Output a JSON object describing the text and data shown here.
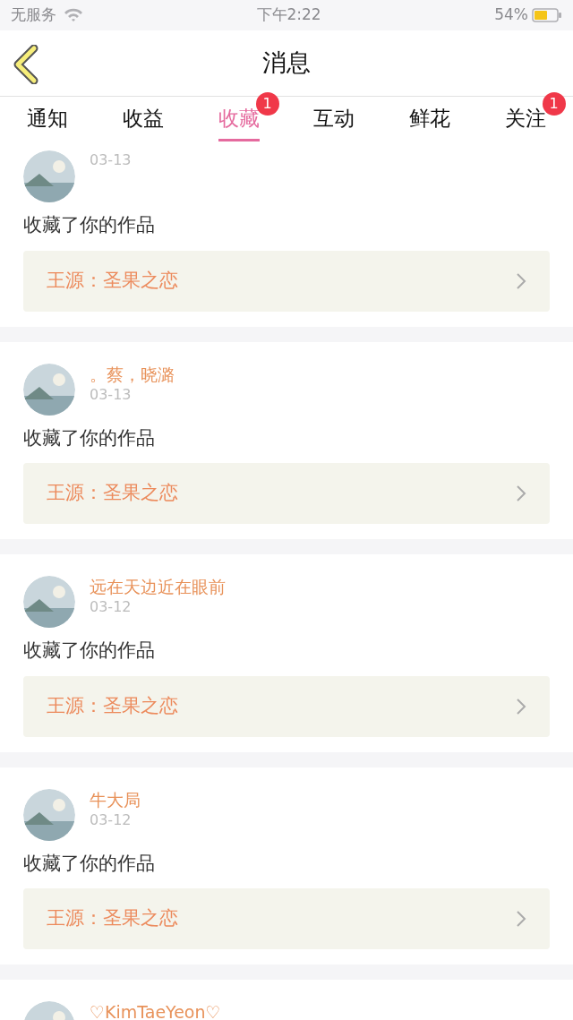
{
  "status_bar": {
    "carrier": "无服务",
    "time": "下午2:22",
    "battery": "54%"
  },
  "header": {
    "title": "消息"
  },
  "tabs": [
    {
      "label": "通知",
      "selected": false
    },
    {
      "label": "收益",
      "selected": false
    },
    {
      "label": "收藏",
      "selected": true,
      "badge": "1"
    },
    {
      "label": "互动",
      "selected": false
    },
    {
      "label": "鲜花",
      "selected": false
    },
    {
      "label": "关注",
      "selected": false,
      "badge": "1"
    }
  ],
  "messages": [
    {
      "date": "03-13",
      "action": "收藏了你的作品",
      "work": "王源：圣果之恋"
    },
    {
      "name": "。蔡，晓潞",
      "date": "03-13",
      "action": "收藏了你的作品",
      "work": "王源：圣果之恋"
    },
    {
      "name": "远在天边近在眼前",
      "date": "03-12",
      "action": "收藏了你的作品",
      "work": "王源：圣果之恋"
    },
    {
      "name": "牛大局",
      "date": "03-12",
      "action": "收藏了你的作品",
      "work": "王源：圣果之恋"
    },
    {
      "name": "♡KimTaeYeon♡"
    }
  ]
}
